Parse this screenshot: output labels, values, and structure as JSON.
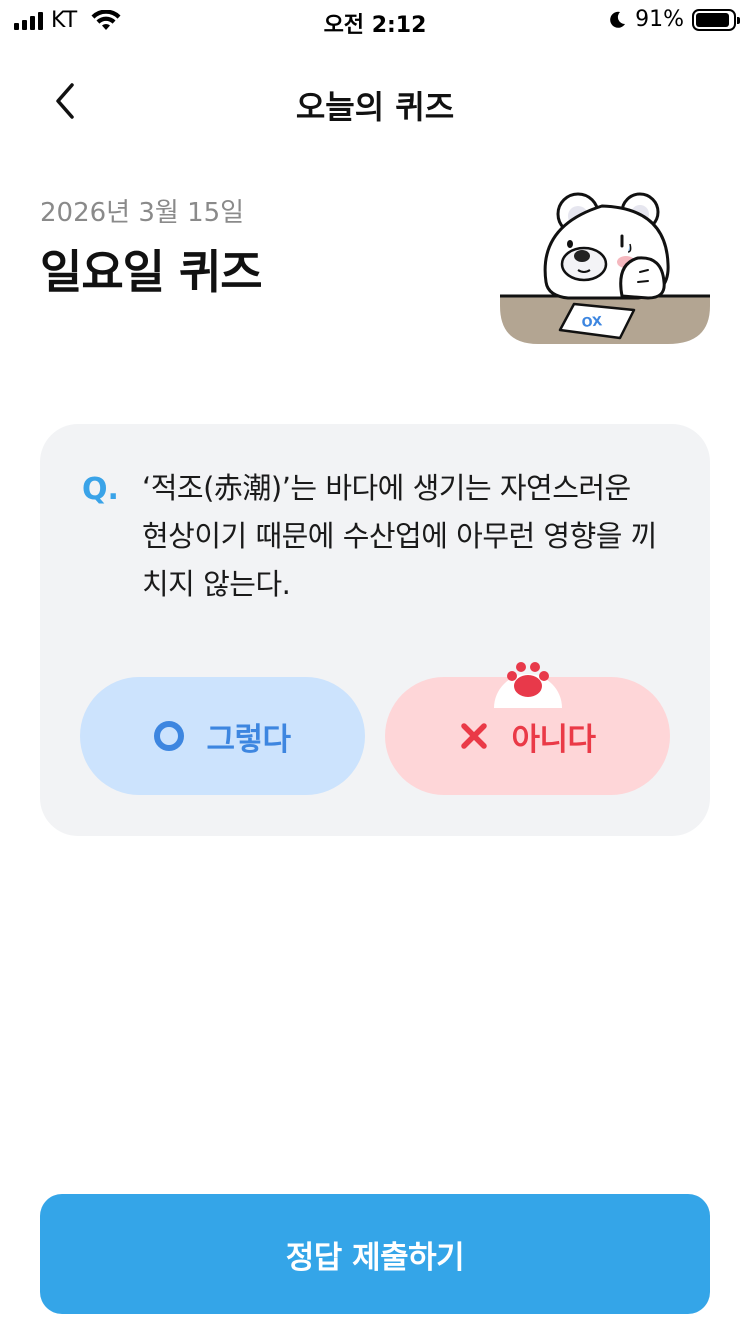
{
  "status_bar": {
    "carrier": "KT",
    "time": "오전 2:12",
    "battery_percent": "91%",
    "battery_level": 0.91
  },
  "nav": {
    "title": "오늘의 퀴즈",
    "back_icon": "chevron-left-icon"
  },
  "header": {
    "date": "2026년 3월 15일",
    "title": "일요일 퀴즈"
  },
  "quiz": {
    "q_mark": "Q.",
    "question": "‘적조(赤潮)’는 바다에 생기는 자연스러운 현상이기 때문에 수산업에 아무런 영향을 끼치지 않는다.",
    "answers": [
      {
        "label": "그렇다",
        "icon": "circle-o-icon",
        "color": "#3d86e0",
        "bg": "#cce3fd"
      },
      {
        "label": "아니다",
        "icon": "x-mark-icon",
        "color": "#ea3a47",
        "bg": "#fed6d8",
        "selected": true
      }
    ],
    "illustration_card_text": "OX"
  },
  "submit": {
    "label": "정답 제출하기",
    "color": "#34a5e8"
  }
}
